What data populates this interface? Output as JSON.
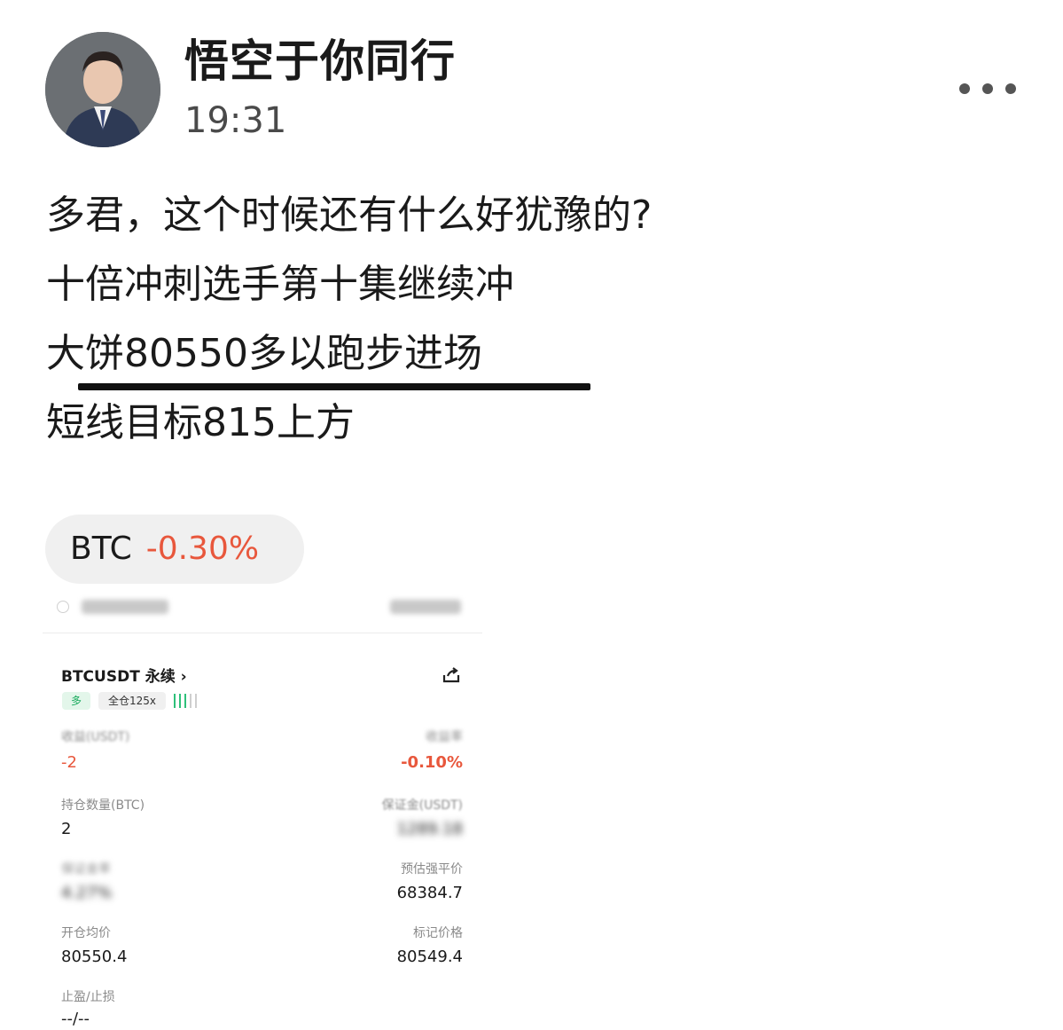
{
  "post": {
    "author": "悟空于你同行",
    "time": "19:31",
    "lines": [
      "多君，这个时候还有什么好犹豫的?",
      "十倍冲刺选手第十集继续冲",
      "大饼80550多以跑步进场",
      "短线目标815上方"
    ],
    "more_icon": "more-dots-icon"
  },
  "ticker_tag": {
    "symbol": "BTC",
    "change": "-0.30%",
    "change_color": "#e8573c"
  },
  "position_card": {
    "pair": "BTCUSDT 永续",
    "chevron": "›",
    "side": "多",
    "margin_mode": "全仓125x",
    "fields": {
      "pnl_label": "收益(USDT)",
      "pnl_value": "-2",
      "roi_label": "收益率",
      "roi_value": "-0.10%",
      "size_label": "持仓数量(BTC)",
      "size_value": "2",
      "margin_label": "保证金(USDT)",
      "margin_value": "1289.18",
      "ratio_label": "保证金率",
      "ratio_value": "4.27%",
      "liq_label": "预估强平价",
      "liq_value": "68384.7",
      "entry_label": "开仓均价",
      "entry_value": "80550.4",
      "mark_label": "标记价格",
      "mark_value": "80549.4",
      "tpsl_label": "止盈/止损",
      "tpsl_value": "--/--"
    }
  }
}
